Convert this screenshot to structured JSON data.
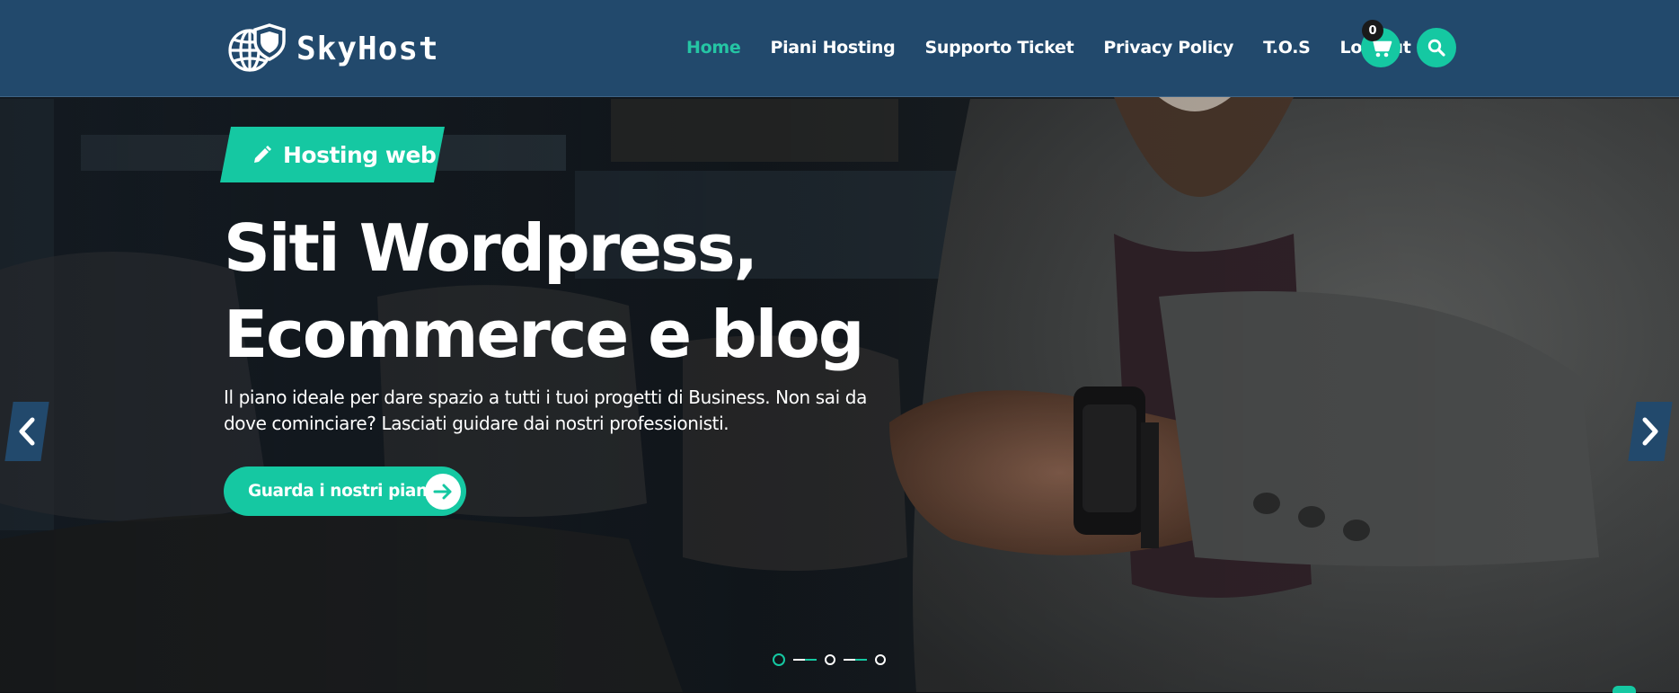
{
  "brand": {
    "name": "SkyHost"
  },
  "nav": {
    "items": [
      {
        "label": "Home",
        "active": true
      },
      {
        "label": "Piani Hosting"
      },
      {
        "label": "Supporto Ticket"
      },
      {
        "label": "Privacy Policy"
      },
      {
        "label": "T.O.S"
      },
      {
        "label": "Log out"
      }
    ]
  },
  "cart": {
    "count": "0",
    "icon": "cart-icon"
  },
  "search": {
    "icon": "search-icon"
  },
  "hero": {
    "badge_label": "Hosting web",
    "badge_icon": "pencil-icon",
    "title_line1": "Siti Wordpress,",
    "title_line2": "Ecommerce e blog",
    "description": "Il piano ideale per dare spazio a tutti i tuoi progetti di Business. Non sai da dove cominciare? Lasciati guidare dai nostri professionisti.",
    "cta_label": "Guarda i nostri piani",
    "cta_icon": "arrow-right-icon"
  },
  "slider": {
    "slide_count": 3,
    "active_slide": 1
  },
  "colors": {
    "header_bg": "#22496c",
    "accent": "#15c8a2",
    "nav_active": "#25c5a4",
    "text": "#ffffff"
  }
}
